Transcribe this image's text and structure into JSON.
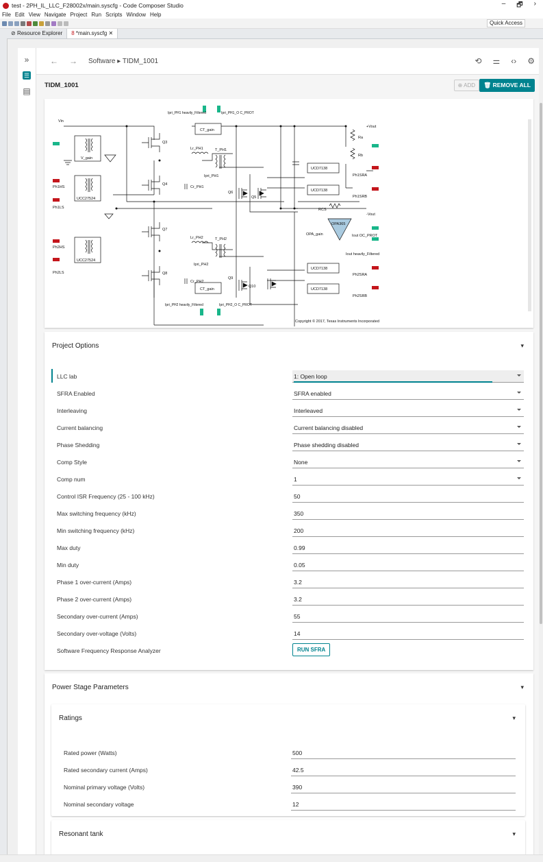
{
  "window": {
    "title": "test - 2PH_IL_LLC_F28002x/main.syscfg - Code Composer Studio",
    "min": "–",
    "max": "🗗",
    "close": "›"
  },
  "menu": [
    "File",
    "Edit",
    "View",
    "Navigate",
    "Project",
    "Run",
    "Scripts",
    "Window",
    "Help"
  ],
  "toolbar": {
    "quick_access": "Quick Access"
  },
  "tabs": [
    {
      "label": "Resource Explorer"
    },
    {
      "label": "*main.syscfg"
    }
  ],
  "nav": {
    "back": "←",
    "forward": "→",
    "breadcrumb": "Software ▸ TIDM_1001"
  },
  "module": {
    "title": "TIDM_1001",
    "add_label": "ADD",
    "remove_label": "REMOVE ALL"
  },
  "diagram": {
    "copyright": "Copyright © 2017, Texas Instruments Incorporated",
    "labels": {
      "vin": "Vin",
      "vgain": "V_gain",
      "ucc1": "UCC27524",
      "ucc2": "UCC27524",
      "ph1hs": "Ph1HS",
      "ph1ls": "Ph1LS",
      "ph2hs": "Ph2HS",
      "ph2ls": "Ph2LS",
      "q3": "Q3",
      "q4": "Q4",
      "q7": "Q7",
      "q8": "Q8",
      "q5": "Q5",
      "q6": "Q6",
      "q9": "Q9",
      "q10": "Q10",
      "lrph1": "Lr_PH1",
      "lrph2": "Lr_PH2",
      "tph1": "T_PH1",
      "tph2": "T_PH2",
      "crph1": "Cr_PH1",
      "crph2": "Cr_PH2",
      "ipriph1": "Ipri_PH1",
      "ipriph2": "Ipri_PH2",
      "ctgain1": "CT_gain",
      "ctgain2": "CT_gain",
      "ipriph1f": "Ipri_PH1 heavily_Filtered",
      "ipriph1o": "Ipri_PH1_O C_PROT",
      "ipriph2f": "Ipri_PH2 heavily_Filtered",
      "ipriph2o": "Ipri_PH2_O C_PROT",
      "ucd1": "UCD7138",
      "ucd2": "UCD7138",
      "ucd3": "UCD7138",
      "ucd4": "UCD7138",
      "ph1sra": "Ph1SRA",
      "ph1srb": "Ph1SRB",
      "ph2sra": "Ph2SRA",
      "ph2srb": "Ph2SRB",
      "vout": "+Vout",
      "nvout": "-Vout",
      "ra": "Ra",
      "rb": "Rb",
      "rcs": "RCS",
      "opa": "OPA365",
      "opagain": "OPA_gain",
      "ioutoc": "Iout OC_PROT",
      "ioutf": "Iout heavily_Filtered"
    }
  },
  "project_options": {
    "title": "Project Options",
    "rows": [
      {
        "label": "LLC lab",
        "value": "1: Open loop",
        "type": "select"
      },
      {
        "label": "SFRA Enabled",
        "value": "SFRA enabled",
        "type": "select"
      },
      {
        "label": "Interleaving",
        "value": "Interleaved",
        "type": "select"
      },
      {
        "label": "Current balancing",
        "value": "Current balancing disabled",
        "type": "select"
      },
      {
        "label": "Phase Shedding",
        "value": "Phase shedding disabled",
        "type": "select"
      },
      {
        "label": "Comp Style",
        "value": "None",
        "type": "select"
      },
      {
        "label": "Comp num",
        "value": "1",
        "type": "select"
      },
      {
        "label": "Control ISR Frequency (25 - 100 kHz)",
        "value": "50",
        "type": "text"
      },
      {
        "label": "Max switching frequency (kHz)",
        "value": "350",
        "type": "text"
      },
      {
        "label": "Min switching frequency (kHz)",
        "value": "200",
        "type": "text"
      },
      {
        "label": "Max duty",
        "value": "0.99",
        "type": "text"
      },
      {
        "label": "Min duty",
        "value": "0.05",
        "type": "text"
      },
      {
        "label": "Phase 1 over-current (Amps)",
        "value": "3.2",
        "type": "text"
      },
      {
        "label": "Phase 2 over-current (Amps)",
        "value": "3.2",
        "type": "text"
      },
      {
        "label": "Secondary over-current (Amps)",
        "value": "55",
        "type": "text"
      },
      {
        "label": "Secondary over-voltage (Volts)",
        "value": "14",
        "type": "text"
      }
    ],
    "sfra_label": "Software Frequency Response Analyzer",
    "sfra_button": "RUN SFRA"
  },
  "power_stage": {
    "title": "Power Stage Parameters",
    "ratings": {
      "title": "Ratings",
      "rows": [
        {
          "label": "Rated power (Watts)",
          "value": "500"
        },
        {
          "label": "Rated secondary current (Amps)",
          "value": "42.5"
        },
        {
          "label": "Nominal primary voltage (Volts)",
          "value": "390"
        },
        {
          "label": "Nominal secondary voltage",
          "value": "12"
        }
      ]
    },
    "resonant_title": "Resonant tank"
  },
  "colors": {
    "accent": "#00838f",
    "red": "#c4161c",
    "green": "#19b68a"
  }
}
